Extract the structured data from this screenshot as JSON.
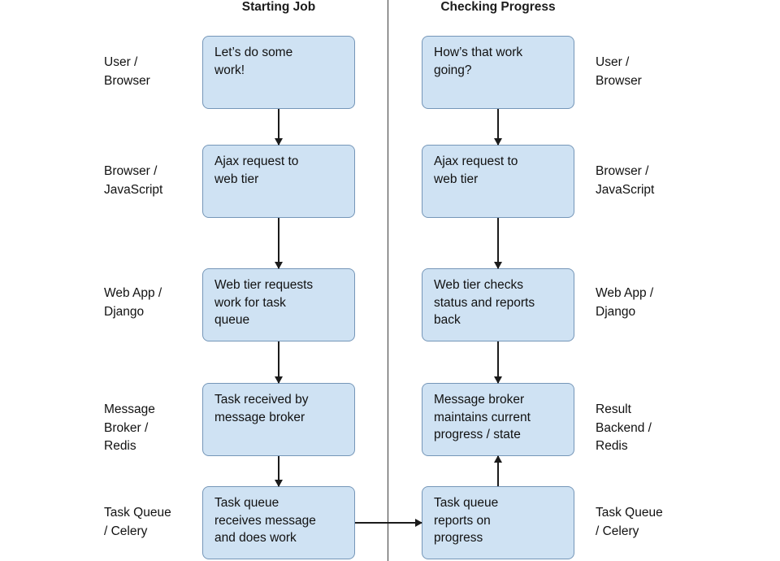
{
  "diagram": {
    "columns": [
      {
        "title": "Starting Job"
      },
      {
        "title": "Checking Progress"
      }
    ],
    "colors": {
      "node_fill": "#cfe2f3",
      "node_border": "#7596b8",
      "arrow": "#1b1b1b",
      "divider": "#3b3b3b",
      "text": "#111111"
    },
    "left_labels": [
      {
        "text": "User /\nBrowser"
      },
      {
        "text": "Browser /\nJavaScript"
      },
      {
        "text": "Web App /\nDjango"
      },
      {
        "text": "Message\nBroker /\nRedis"
      },
      {
        "text": "Task Queue\n/ Celery"
      }
    ],
    "right_labels": [
      {
        "text": "User /\nBrowser"
      },
      {
        "text": "Browser /\nJavaScript"
      },
      {
        "text": "Web App /\nDjango"
      },
      {
        "text": "Result\nBackend /\nRedis"
      },
      {
        "text": "Task Queue\n/ Celery"
      }
    ],
    "left_nodes": [
      {
        "text": "Let’s do some\nwork!"
      },
      {
        "text": "Ajax request to\nweb tier"
      },
      {
        "text": "Web tier requests\nwork for task\nqueue"
      },
      {
        "text": "Task received by\nmessage broker"
      },
      {
        "text": "Task queue\nreceives message\nand does work"
      }
    ],
    "right_nodes": [
      {
        "text": "How’s that work\ngoing?"
      },
      {
        "text": "Ajax request to\nweb tier"
      },
      {
        "text": "Web tier checks\nstatus and reports\nback"
      },
      {
        "text": "Message broker\nmaintains current\nprogress / state"
      },
      {
        "text": "Task queue\nreports on\nprogress"
      }
    ]
  }
}
